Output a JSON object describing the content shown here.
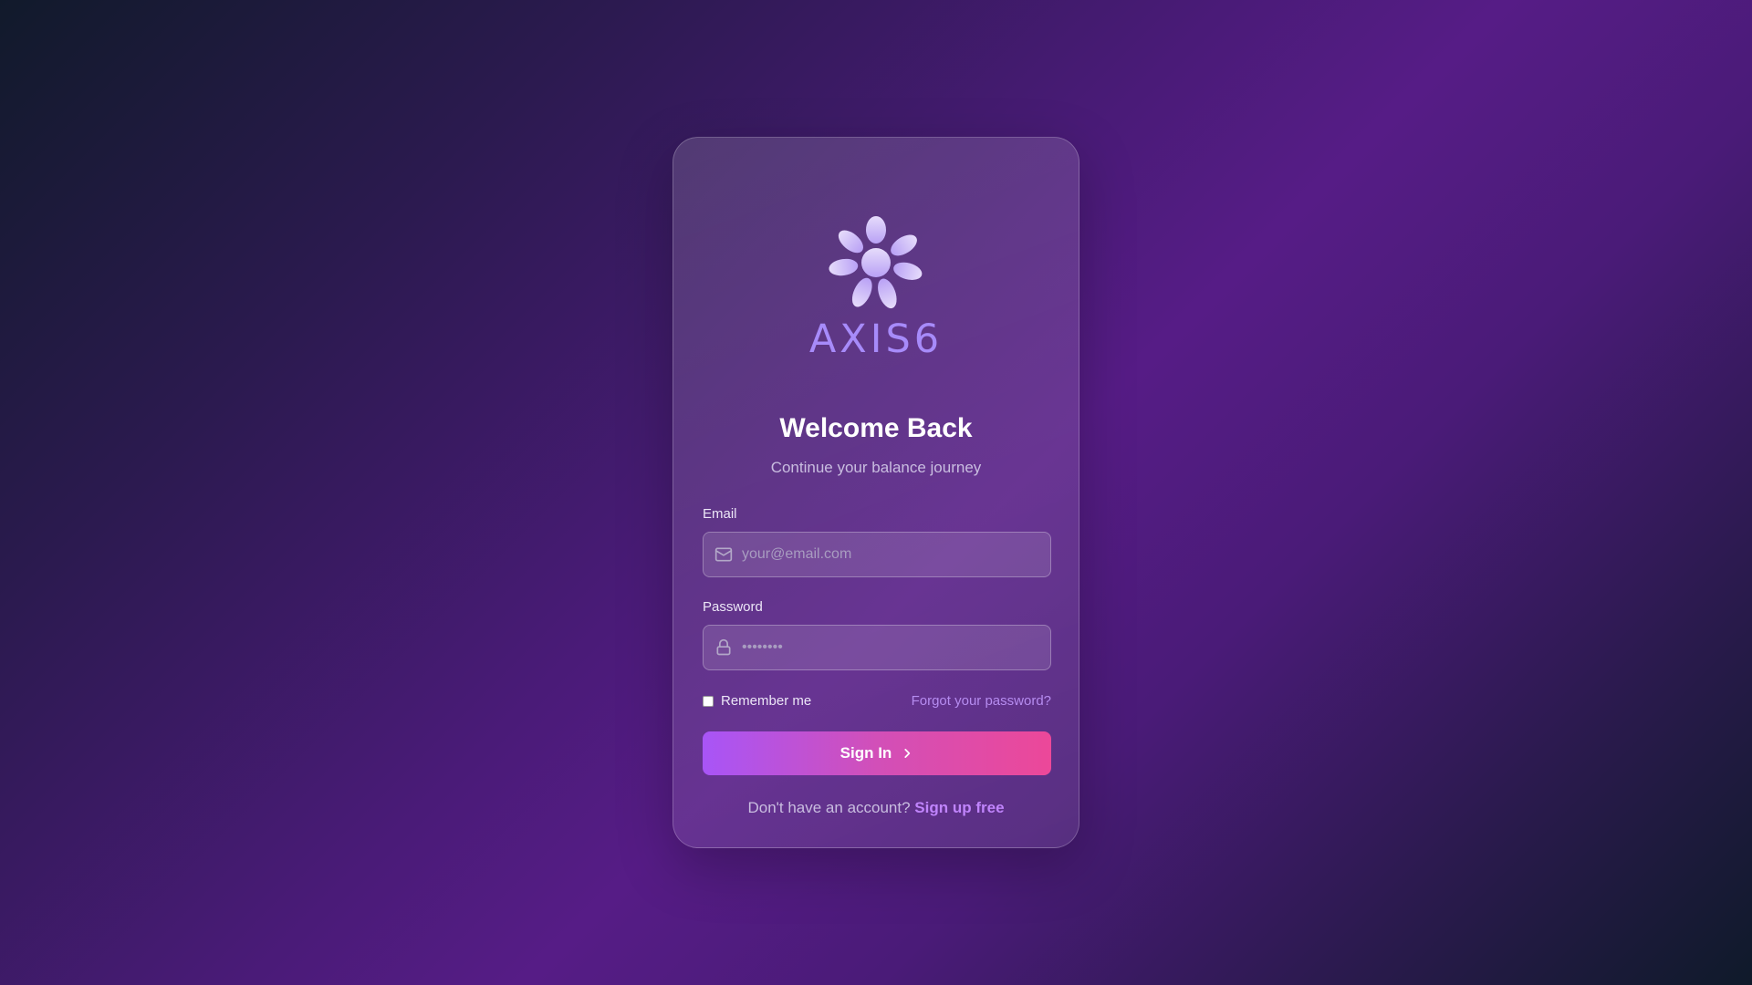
{
  "brand": {
    "name": "AXIS6",
    "logo_icon": "flower-logo-icon",
    "color": "#a78bfa"
  },
  "header": {
    "title": "Welcome Back",
    "subtitle": "Continue your balance journey"
  },
  "form": {
    "email": {
      "label": "Email",
      "placeholder": "your@email.com",
      "value": "",
      "icon": "mail-icon"
    },
    "password": {
      "label": "Password",
      "placeholder": "••••••••",
      "value": "",
      "icon": "lock-icon"
    },
    "remember_label": "Remember me",
    "remember_checked": false,
    "forgot_label": "Forgot your password?",
    "submit_label": "Sign In",
    "submit_icon": "chevron-right-icon"
  },
  "footer": {
    "prompt": "Don't have an account?",
    "link_label": "Sign up free"
  },
  "colors": {
    "accent": "#a855f7",
    "accent_end": "#ec4899",
    "link": "#c084fc"
  }
}
